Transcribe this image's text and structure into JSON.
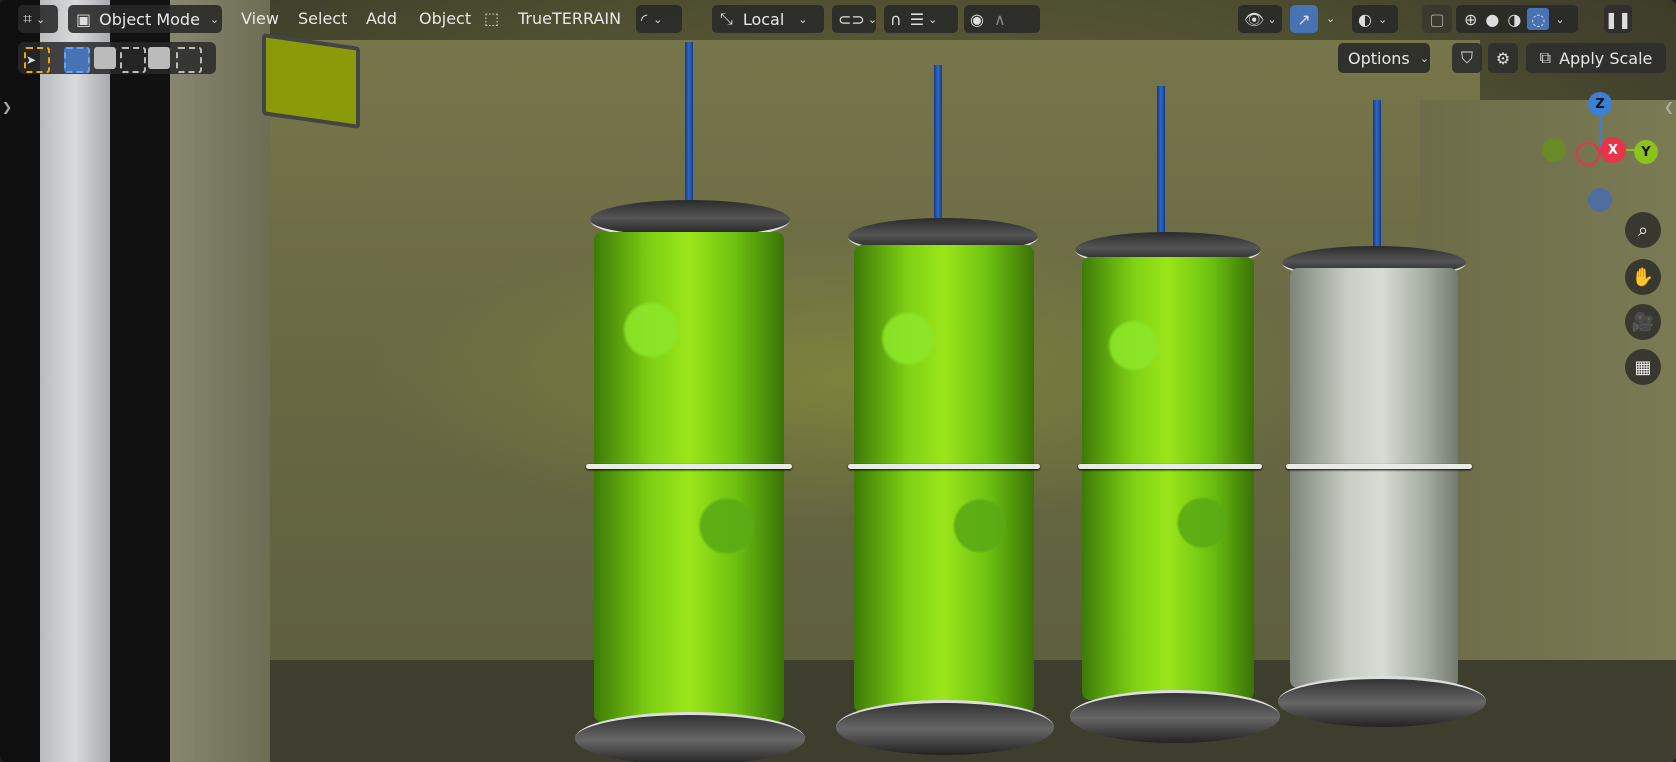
{
  "header": {
    "editor_type_icon": "viewport-icon",
    "mode": "Object Mode",
    "menus": [
      "View",
      "Select",
      "Add",
      "Object"
    ],
    "addon_label": "TrueTERRAIN",
    "transform_orientation": "Local"
  },
  "toolbar": {
    "options_label": "Options",
    "apply_scale_label": "Apply Scale"
  },
  "gizmo": {
    "z": "Z",
    "x": "X",
    "y": "Y",
    "colors": {
      "x": "#e8344a",
      "y": "#8bc21b",
      "z": "#3b7fd6",
      "neg": "#4e6fa0"
    }
  },
  "nav_icons": [
    "zoom-icon",
    "pan-hand-icon",
    "camera-icon",
    "grid-perspective-icon"
  ],
  "scene": {
    "tanks": [
      {
        "liquid": "green"
      },
      {
        "liquid": "green"
      },
      {
        "liquid": "green"
      },
      {
        "liquid": "clear"
      }
    ]
  }
}
